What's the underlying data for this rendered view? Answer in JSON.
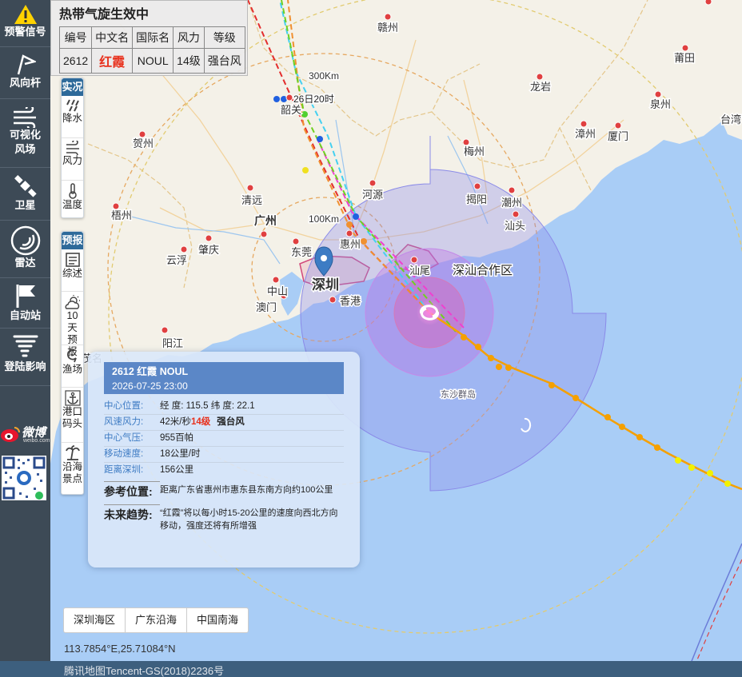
{
  "sidebar": {
    "items": [
      {
        "label": "预警信号",
        "icon": "warning-icon"
      },
      {
        "label": "风向杆",
        "icon": "wind-flag-icon"
      },
      {
        "label": "可视化风场",
        "icon": "wind-field-icon"
      },
      {
        "label": "卫星",
        "icon": "satellite-icon"
      },
      {
        "label": "雷达",
        "icon": "radar-icon"
      },
      {
        "label": "自动站",
        "icon": "flag-icon"
      },
      {
        "label": "登陆影响",
        "icon": "tornado-icon"
      }
    ],
    "weibo_text": "微博",
    "weibo_url_text": "weibo.com"
  },
  "typhoon_table": {
    "title": "热带气旋生效中",
    "headers": [
      "编号",
      "中文名",
      "国际名",
      "风力",
      "等级"
    ],
    "row": {
      "number": "2612",
      "cname": "红霞",
      "iname": "NOUL",
      "wind": "14级",
      "grade": "强台风"
    }
  },
  "live_panel": {
    "header": "实况",
    "items": [
      {
        "label": "降水",
        "icon": "rain-icon"
      },
      {
        "label": "风力",
        "icon": "wind-icon"
      },
      {
        "label": "温度",
        "icon": "thermometer-icon"
      }
    ]
  },
  "forecast_panel": {
    "header": "预报",
    "items": [
      {
        "label": "综述",
        "icon": "document-icon"
      },
      {
        "label": "10天预报",
        "icon": "cloud-sun-icon"
      },
      {
        "label": "渔场",
        "icon": "fish-icon"
      },
      {
        "label": "港口码头",
        "icon": "anchor-icon"
      },
      {
        "label": "沿海景点",
        "icon": "palm-tree-icon"
      }
    ]
  },
  "map": {
    "cities": [
      "赣州",
      "韶关",
      "贺州",
      "梧州",
      "清远",
      "广州",
      "河源",
      "梅州",
      "揭阳",
      "潮州",
      "汕头",
      "漳州",
      "厦门",
      "泉州",
      "莆田",
      "龙岩",
      "台湾",
      "惠州",
      "东莞",
      "深圳",
      "香港",
      "中山",
      "澳门",
      "肇庆",
      "云浮",
      "阳江",
      "汕尾",
      "茂名",
      "东沙群岛"
    ],
    "marker_city": "深圳",
    "area_label": "深汕合作区",
    "ring_labels": [
      "300Km",
      "100Km"
    ],
    "track_label": "26日20时",
    "tab_labels": [
      "深圳海区",
      "广东沿海",
      "中国南海"
    ],
    "coordinates": "113.7854°E,25.71084°N",
    "copyright": "腾讯地图Tencent-GS(2018)2236号"
  },
  "popup": {
    "title": "2612 红霞 NOUL",
    "datetime": "2026-07-25 23:00",
    "center_label": "中心位置:",
    "center_value": "经 度: 115.5  纬 度: 22.1",
    "wind_label": "风速风力:",
    "wind_speed": "42米/秒",
    "wind_level": "14级",
    "wind_grade": "强台风",
    "pressure_label": "中心气压:",
    "pressure_value": "955百帕",
    "move_label": "移动速度:",
    "move_value": "18公里/时",
    "dist_label": "距离深圳:",
    "dist_value": "156公里",
    "ref_label": "参考位置:",
    "ref_value": "距离广东省惠州市惠东县东南方向约100公里",
    "trend_label": "未来趋势:",
    "trend_value": "“红霞”将以每小时15-20公里的速度向西北方向移动，强度还将有所增强"
  },
  "colors": {
    "sidebar": "#3d4a56",
    "sea": "#aacdf7",
    "land": "#f4f2ea",
    "warning": "#e8321e",
    "track_orange": "#f5a000",
    "track_yellow": "#f2f200"
  }
}
